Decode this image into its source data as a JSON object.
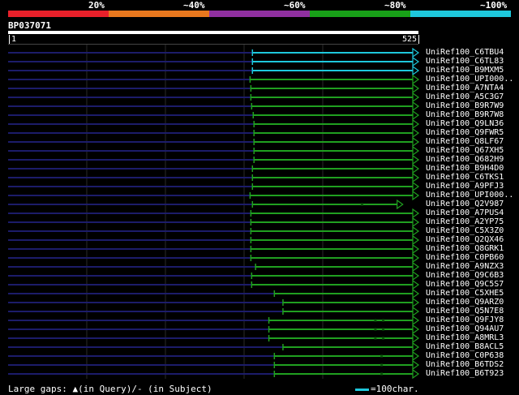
{
  "legend": {
    "segments": [
      {
        "label": "20%",
        "color": "#e8202a"
      },
      {
        "label": "~40%",
        "color": "#e8781e"
      },
      {
        "label": "~60%",
        "color": "#9030a0"
      },
      {
        "label": "~80%",
        "color": "#18a018"
      },
      {
        "label": "~100%",
        "color": "#1ec8dc"
      }
    ]
  },
  "query": {
    "id": "BP037071",
    "start": "1",
    "end": "525",
    "length": 525
  },
  "colors": {
    "cyan": "#1ec8dc",
    "green": "#20a020",
    "navy": "#1c1c6a",
    "grid": "#2a2a2a"
  },
  "hits": [
    {
      "name": "UniRef100_C6TBU4",
      "start": 313,
      "end": 525,
      "color": "cyan",
      "gaps": []
    },
    {
      "name": "UniRef100_C6TL83",
      "start": 313,
      "end": 525,
      "color": "cyan",
      "gaps": []
    },
    {
      "name": "UniRef100_B9MXM5",
      "start": 313,
      "end": 525,
      "color": "cyan",
      "gaps": []
    },
    {
      "name": "UniRef100_UPI000..",
      "start": 310,
      "end": 525,
      "color": "green",
      "gaps": []
    },
    {
      "name": "UniRef100_A7NTA4",
      "start": 311,
      "end": 525,
      "color": "green",
      "gaps": []
    },
    {
      "name": "UniRef100_A5C3G7",
      "start": 311,
      "end": 525,
      "color": "green",
      "gaps": []
    },
    {
      "name": "UniRef100_B9R7W9",
      "start": 312,
      "end": 525,
      "color": "green",
      "gaps": []
    },
    {
      "name": "UniRef100_B9R7W8",
      "start": 314,
      "end": 525,
      "color": "green",
      "gaps": []
    },
    {
      "name": "UniRef100_Q9LN36",
      "start": 315,
      "end": 525,
      "color": "green",
      "gaps": []
    },
    {
      "name": "UniRef100_Q9FWR5",
      "start": 315,
      "end": 525,
      "color": "green",
      "gaps": []
    },
    {
      "name": "UniRef100_Q8LF67",
      "start": 315,
      "end": 525,
      "color": "green",
      "gaps": []
    },
    {
      "name": "UniRef100_Q67XH5",
      "start": 315,
      "end": 525,
      "color": "green",
      "gaps": []
    },
    {
      "name": "UniRef100_Q682H9",
      "start": 315,
      "end": 525,
      "color": "green",
      "gaps": []
    },
    {
      "name": "UniRef100_B9H4D0",
      "start": 313,
      "end": 525,
      "color": "green",
      "gaps": []
    },
    {
      "name": "UniRef100_C6TKS1",
      "start": 313,
      "end": 525,
      "color": "green",
      "gaps": []
    },
    {
      "name": "UniRef100_A9PFJ3",
      "start": 313,
      "end": 525,
      "color": "green",
      "gaps": []
    },
    {
      "name": "UniRef100_UPI000..",
      "start": 310,
      "end": 525,
      "color": "green",
      "gaps": []
    },
    {
      "name": "UniRef100_Q2V987",
      "start": 313,
      "end": 505,
      "color": "green",
      "gaps": [
        453
      ]
    },
    {
      "name": "UniRef100_A7PUS4",
      "start": 311,
      "end": 525,
      "color": "green",
      "gaps": []
    },
    {
      "name": "UniRef100_A2YP75",
      "start": 311,
      "end": 525,
      "color": "green",
      "gaps": []
    },
    {
      "name": "UniRef100_C5X3Z0",
      "start": 311,
      "end": 525,
      "color": "green",
      "gaps": []
    },
    {
      "name": "UniRef100_Q2QX46",
      "start": 311,
      "end": 525,
      "color": "green",
      "gaps": []
    },
    {
      "name": "UniRef100_Q8GRK1",
      "start": 311,
      "end": 525,
      "color": "green",
      "gaps": []
    },
    {
      "name": "UniRef100_C0PB60",
      "start": 311,
      "end": 525,
      "color": "green",
      "gaps": []
    },
    {
      "name": "UniRef100_A9NZX3",
      "start": 317,
      "end": 525,
      "color": "green",
      "gaps": []
    },
    {
      "name": "UniRef100_Q9C6B3",
      "start": 312,
      "end": 525,
      "color": "green",
      "gaps": []
    },
    {
      "name": "UniRef100_Q9C5S7",
      "start": 312,
      "end": 525,
      "color": "green",
      "gaps": []
    },
    {
      "name": "UniRef100_C5XHE5",
      "start": 341,
      "end": 525,
      "color": "green",
      "gaps": []
    },
    {
      "name": "UniRef100_Q9ARZ0",
      "start": 352,
      "end": 525,
      "color": "green",
      "gaps": []
    },
    {
      "name": "UniRef100_Q5N7E8",
      "start": 352,
      "end": 525,
      "color": "green",
      "gaps": []
    },
    {
      "name": "UniRef100_Q9FJY8",
      "start": 334,
      "end": 525,
      "color": "green",
      "gaps": [
        470,
        480
      ]
    },
    {
      "name": "UniRef100_Q94AU7",
      "start": 334,
      "end": 525,
      "color": "green",
      "gaps": [
        470,
        480
      ]
    },
    {
      "name": "UniRef100_A8MRL3",
      "start": 334,
      "end": 525,
      "color": "green",
      "gaps": [
        470,
        480
      ]
    },
    {
      "name": "UniRef100_B8ACL5",
      "start": 352,
      "end": 525,
      "color": "green",
      "gaps": []
    },
    {
      "name": "UniRef100_C0P638",
      "start": 341,
      "end": 525,
      "color": "green",
      "gaps": [
        478
      ]
    },
    {
      "name": "UniRef100_B6TDS2",
      "start": 341,
      "end": 525,
      "color": "green",
      "gaps": [
        478
      ]
    },
    {
      "name": "UniRef100_B6T923",
      "start": 341,
      "end": 525,
      "color": "green",
      "gaps": [
        478
      ]
    }
  ],
  "footer": {
    "gaps_text": "Large gaps: ▲(in Query)/- (in Subject)",
    "scale_text": "=100char."
  }
}
